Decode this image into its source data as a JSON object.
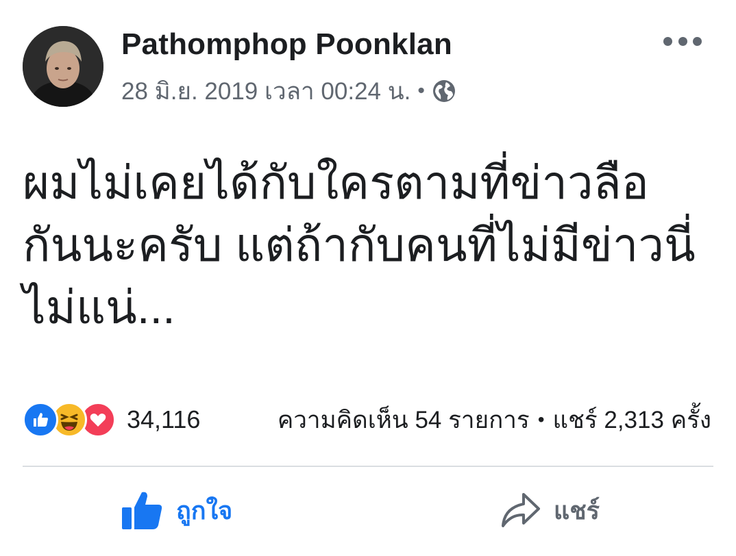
{
  "post": {
    "author": "Pathomphop Poonklan",
    "timestamp": "28 มิ.ย. 2019 เวลา 00:24 น.",
    "meta_separator": "•",
    "privacy_icon": "globe-icon",
    "text_lines": [
      "ผมไม่เคยได้กับใครตามที่ข่าวลือ",
      "กันนะครับ แต่ถ้ากับคนที่ไม่มีข่าวนี่",
      "ไม่แน่..."
    ]
  },
  "reactions": {
    "icons": [
      "like-reaction-icon",
      "haha-reaction-icon",
      "love-reaction-icon"
    ],
    "count": "34,116"
  },
  "stats": {
    "comments": "ความคิดเห็น 54 รายการ",
    "separator": "•",
    "shares": "แชร์ 2,313 ครั้ง"
  },
  "actions": {
    "like_label": "ถูกใจ",
    "share_label": "แชร์"
  },
  "colors": {
    "brand_blue": "#1877f2",
    "secondary_text": "#606770",
    "primary_text": "#1c1e21",
    "love_red": "#f33e58",
    "haha_yellow": "#f7b928"
  }
}
